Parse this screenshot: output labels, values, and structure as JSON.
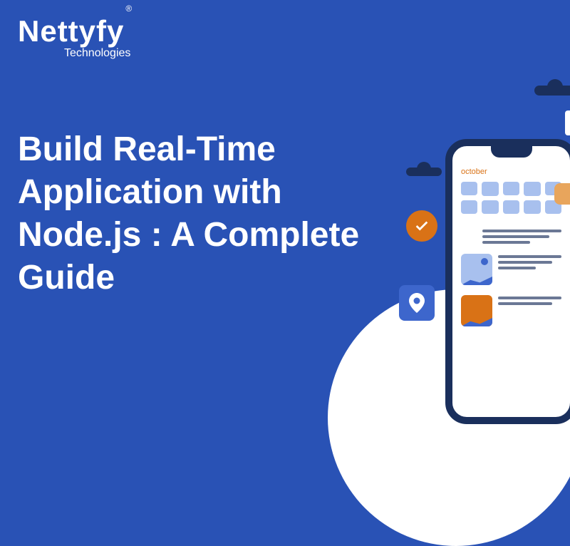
{
  "logo": {
    "brand_name": "Nettyfy",
    "registered_mark": "®",
    "subtitle": "Technologies"
  },
  "headline": "Build Real-Time Application with Node.js : A Complete Guide",
  "phone": {
    "calendar_month": "october"
  },
  "colors": {
    "background": "#2952b5",
    "accent_orange": "#d97216",
    "dark_navy": "#1a2f5c",
    "light_blue": "#a8c0ee",
    "mid_blue": "#3d66cc"
  }
}
